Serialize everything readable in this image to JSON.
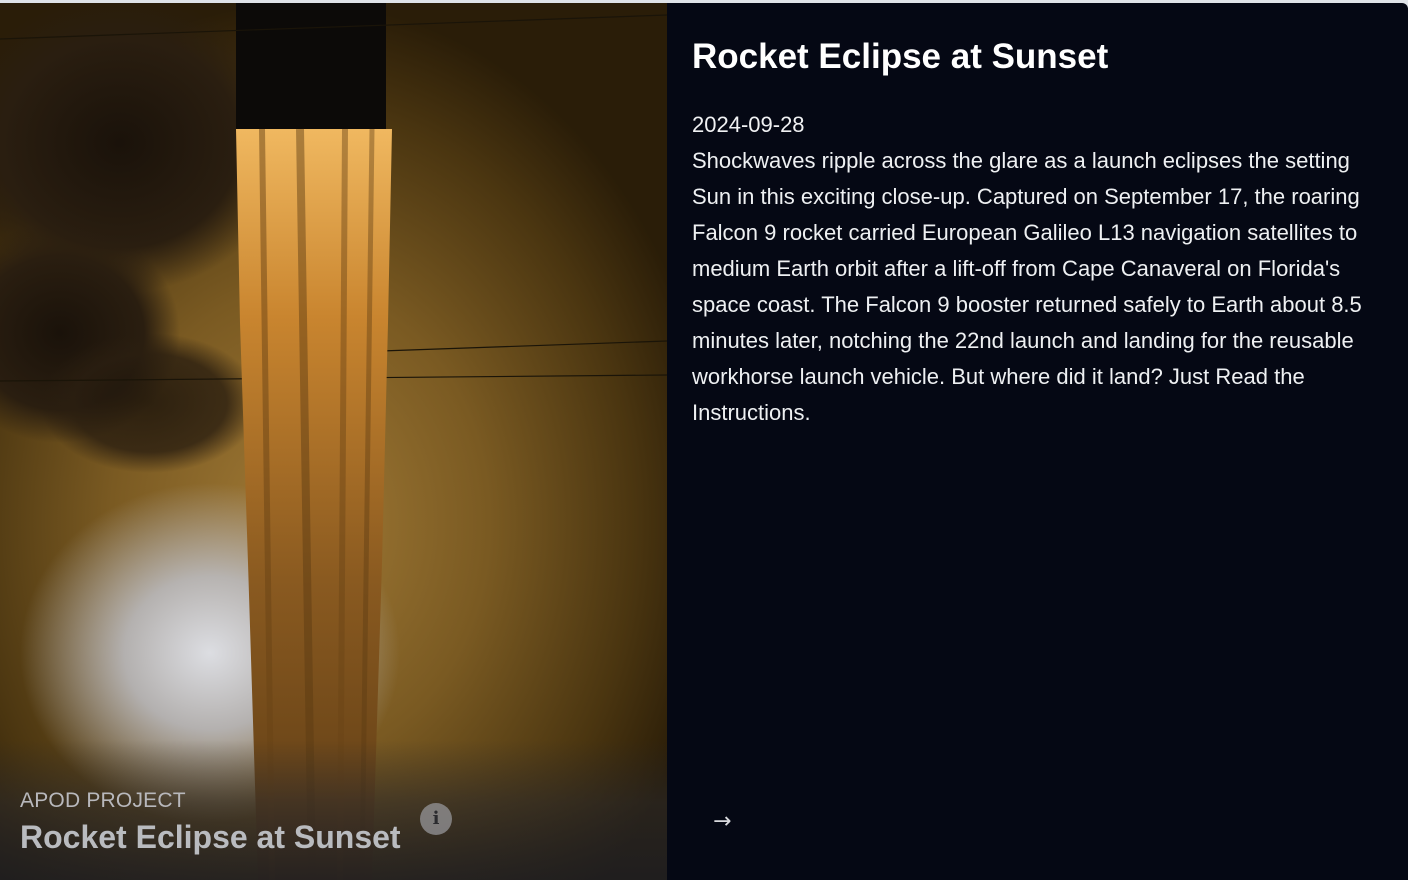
{
  "card": {
    "project_label": "APOD PROJECT",
    "image_title": "Rocket Eclipse at Sunset",
    "info_icon": "i",
    "title": "Rocket Eclipse at Sunset",
    "date": "2024-09-28",
    "explanation": "Shockwaves ripple across the glare as a launch eclipses the setting Sun in this exciting close-up. Captured on September 17, the roaring Falcon 9 rocket carried European Galileo L13 navigation satellites to medium Earth orbit after a lift-off from Cape Canaveral on Florida's space coast. The Falcon 9 booster returned safely to Earth about 8.5 minutes later, notching the 22nd launch and landing for the reusable workhorse launch vehicle. But where did it land? Just Read the Instructions.",
    "next_icon": "→"
  },
  "icons": {
    "info": "info-icon",
    "next": "arrow-right-icon"
  },
  "colors": {
    "panel_background": "#050814",
    "text": "#f2f3f5",
    "sunset_glow": "#a17a36"
  }
}
